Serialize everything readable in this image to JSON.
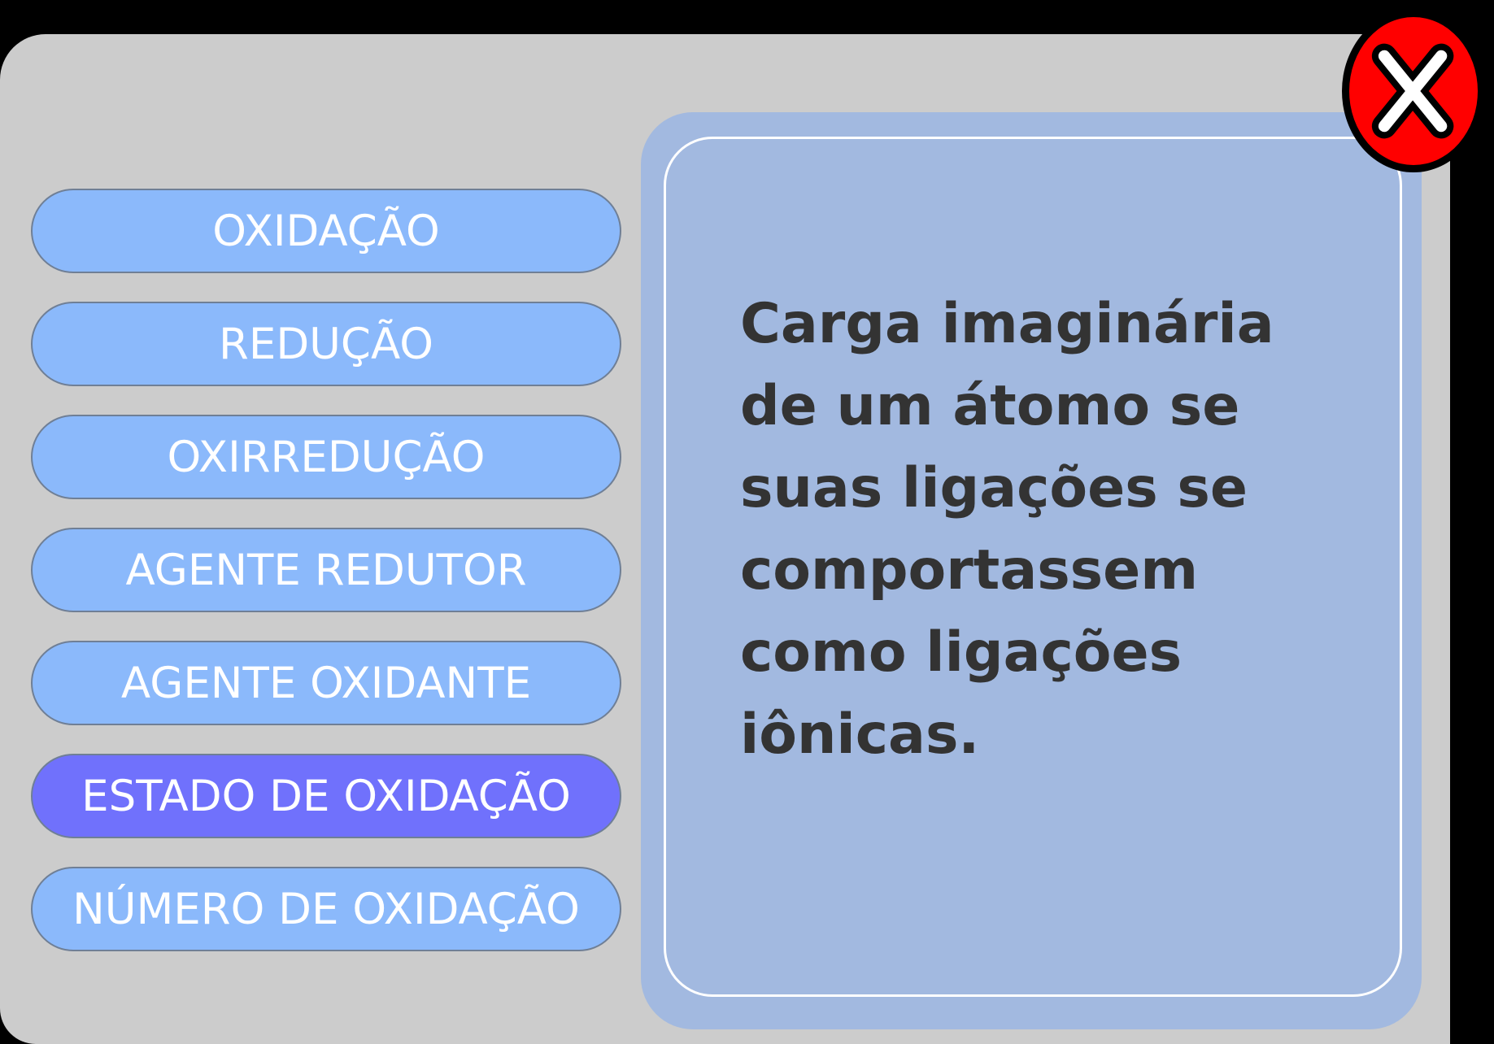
{
  "menu": {
    "items": [
      {
        "label": "OXIDAÇÃO",
        "active": false
      },
      {
        "label": "REDUÇÃO",
        "active": false
      },
      {
        "label": "OXIRREDUÇÃO",
        "active": false
      },
      {
        "label": "AGENTE REDUTOR",
        "active": false
      },
      {
        "label": "AGENTE OXIDANTE",
        "active": false
      },
      {
        "label": "ESTADO DE OXIDAÇÃO",
        "active": true
      },
      {
        "label": "NÚMERO DE OXIDAÇÃO",
        "active": false
      }
    ]
  },
  "panel": {
    "definition": "Carga imaginária\nde um átomo se\nsuas ligações se\ncomportassem\ncomo ligações\niônicas."
  },
  "close_button": {
    "icon": "close-x-icon"
  },
  "colors": {
    "window_bg": "#cccccc",
    "button": "#8bb9fb",
    "button_active": "#7071fc",
    "panel": "#a2b9e0",
    "close_red": "#ff0000",
    "text_dark": "#333333"
  }
}
